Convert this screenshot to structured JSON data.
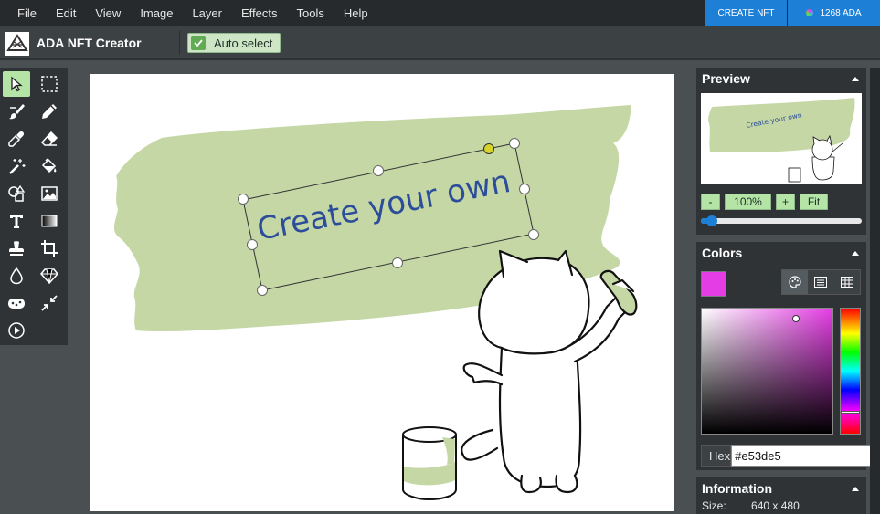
{
  "menu": [
    "File",
    "Edit",
    "View",
    "Image",
    "Layer",
    "Effects",
    "Tools",
    "Help"
  ],
  "top_buttons": {
    "create": "CREATE NFT",
    "balance": "1268 ADA"
  },
  "app": {
    "title": "ADA NFT Creator"
  },
  "attributes": {
    "auto_select": "Auto select"
  },
  "tools": [
    {
      "name": "select-tool",
      "icon": "cursor-icon",
      "active": true
    },
    {
      "name": "selection-tool",
      "icon": "dashed-rect-icon"
    },
    {
      "name": "brush-tool",
      "icon": "brush-icon"
    },
    {
      "name": "pencil-tool",
      "icon": "pencil-icon"
    },
    {
      "name": "pick-color-tool",
      "icon": "eyedropper-icon"
    },
    {
      "name": "erase-tool",
      "icon": "eraser-icon"
    },
    {
      "name": "magic-erase-tool",
      "icon": "magic-wand-icon"
    },
    {
      "name": "fill-tool",
      "icon": "paint-bucket-icon"
    },
    {
      "name": "shape-tool",
      "icon": "shapes-icon"
    },
    {
      "name": "media-tool",
      "icon": "image-icon"
    },
    {
      "name": "text-tool",
      "icon": "text-icon"
    },
    {
      "name": "gradient-tool",
      "icon": "gradient-icon"
    },
    {
      "name": "clone-tool",
      "icon": "stamp-icon"
    },
    {
      "name": "crop-tool",
      "icon": "crop-icon"
    },
    {
      "name": "blur-tool",
      "icon": "drop-icon"
    },
    {
      "name": "sharpen-tool",
      "icon": "diamond-icon"
    },
    {
      "name": "bulge-tool",
      "icon": "sponge-icon"
    },
    {
      "name": "resize-tool",
      "icon": "shrink-arrows-icon"
    },
    {
      "name": "animation-tool",
      "icon": "play-icon"
    }
  ],
  "canvas": {
    "text": "Create your own"
  },
  "preview": {
    "title": "Preview",
    "minus": "-",
    "zoom": "100%",
    "plus": "+",
    "fit": "Fit"
  },
  "colors": {
    "title": "Colors",
    "hex_label": "Hex",
    "hex_value": "#e53de5",
    "current": "#e53de5"
  },
  "info": {
    "title": "Information",
    "size_label": "Size:",
    "size_value": "640 x 480"
  }
}
